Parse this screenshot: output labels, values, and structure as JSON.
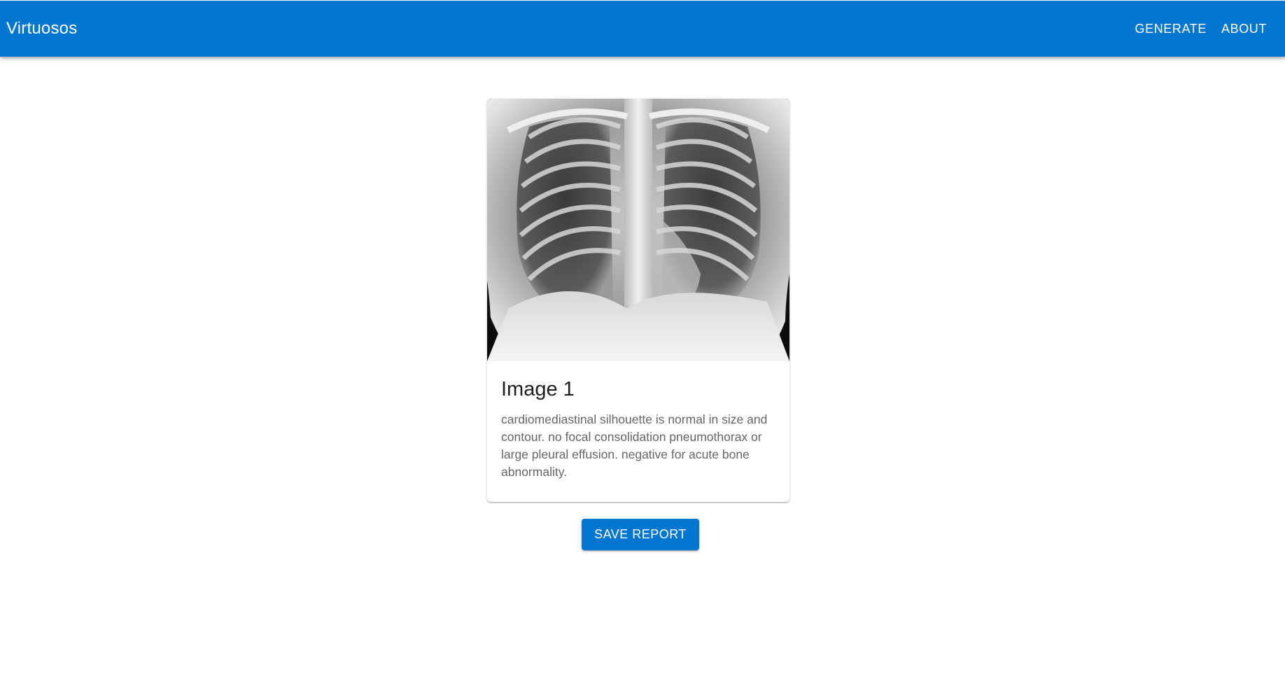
{
  "appbar": {
    "brand": "Virtuosos",
    "nav": [
      "GENERATE",
      "ABOUT"
    ],
    "color": "#0376cf"
  },
  "card": {
    "image_alt_icon": "chest-xray-image",
    "title": "Image 1",
    "report": "cardiomediastinal silhouette is normal in size and contour. no focal consolidation pneumothorax or large pleural effusion. negative for acute bone abnormality."
  },
  "actions": {
    "save_label": "SAVE REPORT"
  }
}
